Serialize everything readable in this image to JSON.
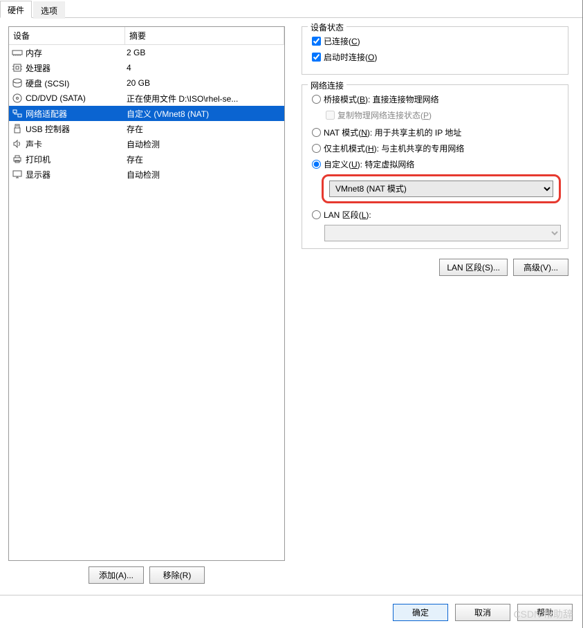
{
  "tabs": {
    "hardware": "硬件",
    "options": "选项"
  },
  "columns": {
    "device": "设备",
    "summary": "摘要"
  },
  "devices": [
    {
      "icon": "memory",
      "label": "内存",
      "summary": "2 GB",
      "selected": false
    },
    {
      "icon": "cpu",
      "label": "处理器",
      "summary": "4",
      "selected": false
    },
    {
      "icon": "disk",
      "label": "硬盘 (SCSI)",
      "summary": "20 GB",
      "selected": false
    },
    {
      "icon": "disc",
      "label": "CD/DVD (SATA)",
      "summary": "正在使用文件 D:\\ISO\\rhel-se...",
      "selected": false
    },
    {
      "icon": "network",
      "label": "网络适配器",
      "summary": "自定义 (VMnet8 (NAT)",
      "selected": true
    },
    {
      "icon": "usb",
      "label": "USB 控制器",
      "summary": "存在",
      "selected": false
    },
    {
      "icon": "sound",
      "label": "声卡",
      "summary": "自动检测",
      "selected": false
    },
    {
      "icon": "printer",
      "label": "打印机",
      "summary": "存在",
      "selected": false
    },
    {
      "icon": "display",
      "label": "显示器",
      "summary": "自动检测",
      "selected": false
    }
  ],
  "buttons": {
    "add": "添加(A)...",
    "remove": "移除(R)",
    "lan_segments": "LAN 区段(S)...",
    "advanced": "高级(V)...",
    "ok": "确定",
    "cancel": "取消",
    "help": "帮助"
  },
  "status_group": {
    "title": "设备状态",
    "connected": {
      "label": "已连接(",
      "hotkey": "C",
      "suffix": ")",
      "checked": true
    },
    "connect_at_poweron": {
      "label": "启动时连接(",
      "hotkey": "O",
      "suffix": ")",
      "checked": true
    }
  },
  "net_group": {
    "title": "网络连接",
    "bridged": {
      "label": "桥接模式(",
      "hotkey": "B",
      "suffix": "): 直接连接物理网络"
    },
    "replicate": {
      "label": "复制物理网络连接状态(",
      "hotkey": "P",
      "suffix": ")"
    },
    "nat": {
      "label": "NAT 模式(",
      "hotkey": "N",
      "suffix": "): 用于共享主机的 IP 地址"
    },
    "hostonly": {
      "label": "仅主机模式(",
      "hotkey": "H",
      "suffix": "): 与主机共享的专用网络"
    },
    "custom": {
      "label": "自定义(",
      "hotkey": "U",
      "suffix": "): 特定虚拟网络"
    },
    "custom_select": "VMnet8 (NAT 模式)",
    "lanseg": {
      "label": "LAN 区段(",
      "hotkey": "L",
      "suffix": "):"
    }
  },
  "watermark": "CSDN 帮助辞"
}
